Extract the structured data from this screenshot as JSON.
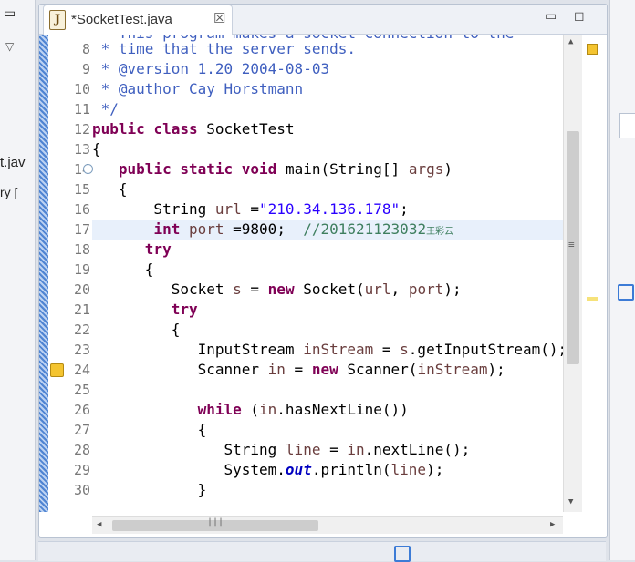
{
  "left_panel": {
    "window_icon": "▭",
    "chevron": "▽",
    "item1": "t.jav",
    "item2": "ry ["
  },
  "editor": {
    "tab_label": "*SocketTest.java",
    "tab_close": "☒",
    "tab_icon_letter": "J",
    "minimize": "▭",
    "maximize": "◻"
  },
  "lines": [
    {
      "num": "8",
      "html": "<span class=\"cm\"> * time that the server sends.</span>"
    },
    {
      "num": "9",
      "html": "<span class=\"cm\"> * @version 1.20 2004-08-03</span>"
    },
    {
      "num": "10",
      "html": "<span class=\"cm\"> * @author Cay Horstmann</span>"
    },
    {
      "num": "11",
      "html": "<span class=\"cm\"> */</span>"
    },
    {
      "num": "12",
      "html": "<span class=\"kw\">public</span> <span class=\"kw\">class</span> SocketTest"
    },
    {
      "num": "13",
      "html": "{"
    },
    {
      "num": "14",
      "html": "   <span class=\"kw\">public</span> <span class=\"kw\">static</span> <span class=\"kw\">void</span> main(String[] <span class=\"vr\">args</span>)"
    },
    {
      "num": "15",
      "html": "   {"
    },
    {
      "num": "16",
      "html": "       String <span class=\"vr\">url</span> =<span class=\"st\">\"210.34.136.178\"</span>;"
    },
    {
      "num": "17",
      "html": "       <span class=\"kw\">int</span> <span class=\"vr\">port</span> =9800;  <span class=\"lc\">//201621123032<span class=\"ch\">王彩云</span></span>"
    },
    {
      "num": "18",
      "html": "      <span class=\"kw\">try</span>"
    },
    {
      "num": "19",
      "html": "      {"
    },
    {
      "num": "20",
      "html": "         Socket <span class=\"vr\">s</span> = <span class=\"kw\">new</span> Socket(<span class=\"vr\">url</span>, <span class=\"vr\">port</span>);"
    },
    {
      "num": "21",
      "html": "         <span class=\"kw\">try</span>"
    },
    {
      "num": "22",
      "html": "         {"
    },
    {
      "num": "23",
      "html": "            InputStream <span class=\"vr\">inStream</span> = <span class=\"vr\">s</span>.getInputStream();"
    },
    {
      "num": "24",
      "html": "            Scanner <span class=\"vr\">in</span> = <span class=\"kw\">new</span> Scanner(<span class=\"vr\">inStream</span>);"
    },
    {
      "num": "25",
      "html": ""
    },
    {
      "num": "26",
      "html": "            <span class=\"kw\">while</span> (<span class=\"vr\">in</span>.hasNextLine())"
    },
    {
      "num": "27",
      "html": "            {"
    },
    {
      "num": "28",
      "html": "               String <span class=\"vr\">line</span> = <span class=\"vr\">in</span>.nextLine();"
    },
    {
      "num": "29",
      "html": "               System.<span class=\"it\">out</span>.println(<span class=\"vr\">line</span>);"
    },
    {
      "num": "30",
      "html": "            }"
    }
  ],
  "scroll": {
    "up": "▲",
    "down": "▼",
    "left": "◀",
    "right": "▶",
    "grip": "≡",
    "hgrip": "|||"
  },
  "colors": {
    "keyword": "#7f0055",
    "javadoc": "#3f5fbf",
    "line_comment": "#3f7f5f",
    "string": "#2a00ff",
    "current_line": "#e8f0fb"
  }
}
